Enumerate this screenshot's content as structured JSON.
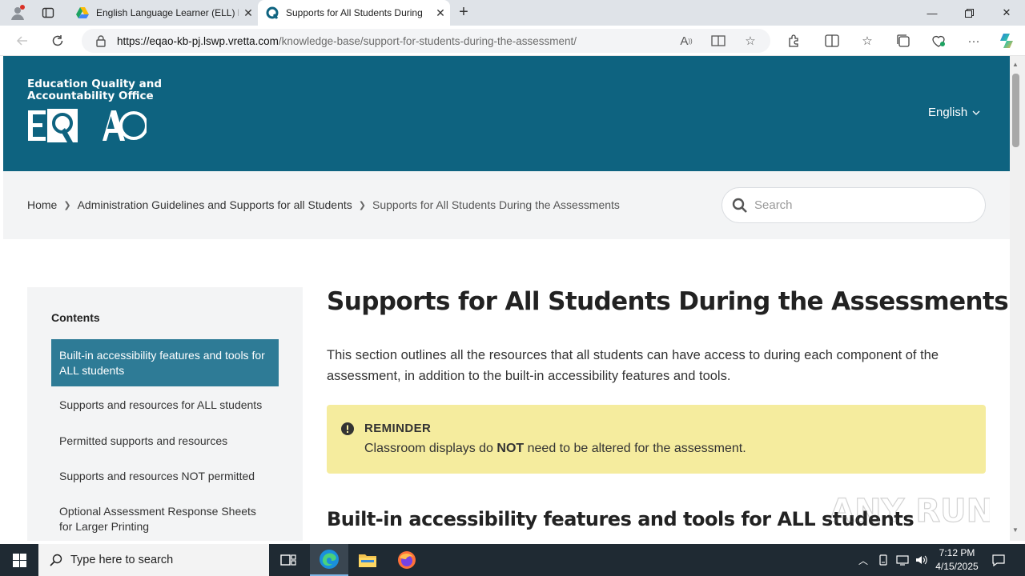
{
  "browser": {
    "tabs": [
      {
        "title": "English Language Learner (ELL) P",
        "active": false
      },
      {
        "title": "Supports for All Students During",
        "active": true
      }
    ],
    "url": {
      "host": "https://eqao-kb-pj.lswp.vretta.com",
      "path": "/knowledge-base/support-for-students-during-the-assessment/"
    }
  },
  "header": {
    "org_line1": "Education Quality and",
    "org_line2": "Accountability Office",
    "logo_text": "EQAO",
    "language": "English"
  },
  "breadcrumb": {
    "items": [
      "Home",
      "Administration Guidelines and Supports for all Students",
      "Supports for All Students During the Assessments"
    ]
  },
  "search": {
    "placeholder": "Search"
  },
  "toc": {
    "title": "Contents",
    "items": [
      "Built-in accessibility features and tools for ALL students",
      "Supports and resources for ALL students",
      "Permitted supports and resources",
      "Supports and resources NOT permitted",
      "Optional Assessment Response Sheets for Larger Printing"
    ]
  },
  "content": {
    "title": "Supports for All Students During the Assessments",
    "intro": "This section outlines all the resources that all students can have access to during each component of the assessment, in addition to the built-in accessibility features and tools.",
    "reminder": {
      "label": "REMINDER",
      "text_before": "Classroom displays do ",
      "text_bold": "NOT",
      "text_after": " need to be altered for the assessment."
    },
    "section_heading": "Built-in accessibility features and tools for ALL students"
  },
  "watermark": {
    "text": "ANY RUN"
  },
  "taskbar": {
    "search_placeholder": "Type here to search",
    "time": "7:12 PM",
    "date": "4/15/2025"
  },
  "colors": {
    "header_bg": "#0e6380",
    "toc_active": "#2e7b96",
    "reminder_bg": "#f5ec9e"
  }
}
